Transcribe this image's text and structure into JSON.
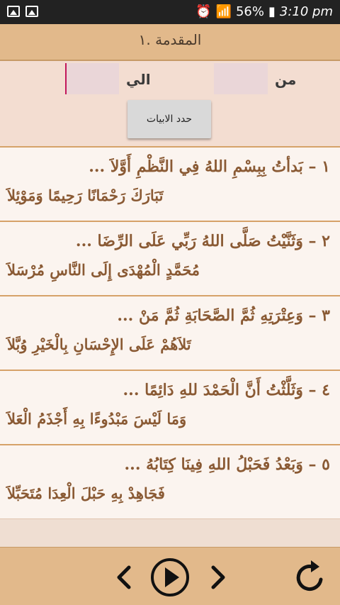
{
  "status_bar": {
    "battery": "56%",
    "time": "3:10 pm",
    "icons": [
      "image-icon",
      "photo-icon",
      "alarm-icon",
      "wifi-icon",
      "signal-icon",
      "battery-icon"
    ]
  },
  "title": {
    "text": "المقدمة .١"
  },
  "range": {
    "from_label": "من",
    "to_label": "الي",
    "from_value": "",
    "to_value": "",
    "limit_button": "حدد الابيات"
  },
  "verses": [
    {
      "number": "١",
      "first": "بَدأتُ بِبِسْمِ اللهُ فِي النَّظْمِ أَوَّلاَ ...",
      "second": "تَبَارَكَ رَحْمَانًا رَحِيمًا وَمَوْئِلاَ"
    },
    {
      "number": "٢",
      "first": "وَثَنَّيْتُ صَلَّى اللهُ رَبِّي عَلَى الرِّضَا ...",
      "second": "مُحَمَّدٍ الْمُهْدَى إِلَى النَّاسِ مُرْسَلاَ"
    },
    {
      "number": "٣",
      "first": "وَعِتْرَتِهِ ثُمَّ الصَّحَابَةِ ثُمَّ مَنْ ...",
      "second": "تَلاَهُمْ عَلَى الإِحْسَانِ بِالْخَيْرِ وُبَّلاَ"
    },
    {
      "number": "٤",
      "first": "وَثَلَّثْتُ أَنَّ الْحَمْدَ للهِ دَائِمًا ...",
      "second": "وَمَا لَيْسَ مَبْدُوءًا بِهِ أَجْذَمُ الْعَلاَ"
    },
    {
      "number": "٥",
      "first": "وَبَعْدُ فَحَبْلُ اللهِ فِينَا كِتَابُهُ ...",
      "second": "فَجَاهِدْ بِهِ حَبْلَ الْعِدَا مُتَحَبِّلاَ"
    }
  ],
  "controls": {
    "prev": "chevron-left-icon",
    "play": "play-icon",
    "next": "chevron-right-icon",
    "reload": "reload-icon"
  },
  "colors": {
    "header": "#e2b98b",
    "panel": "#f3ddd1",
    "verse_text": "#8a5a34",
    "divider": "#d6a269"
  }
}
